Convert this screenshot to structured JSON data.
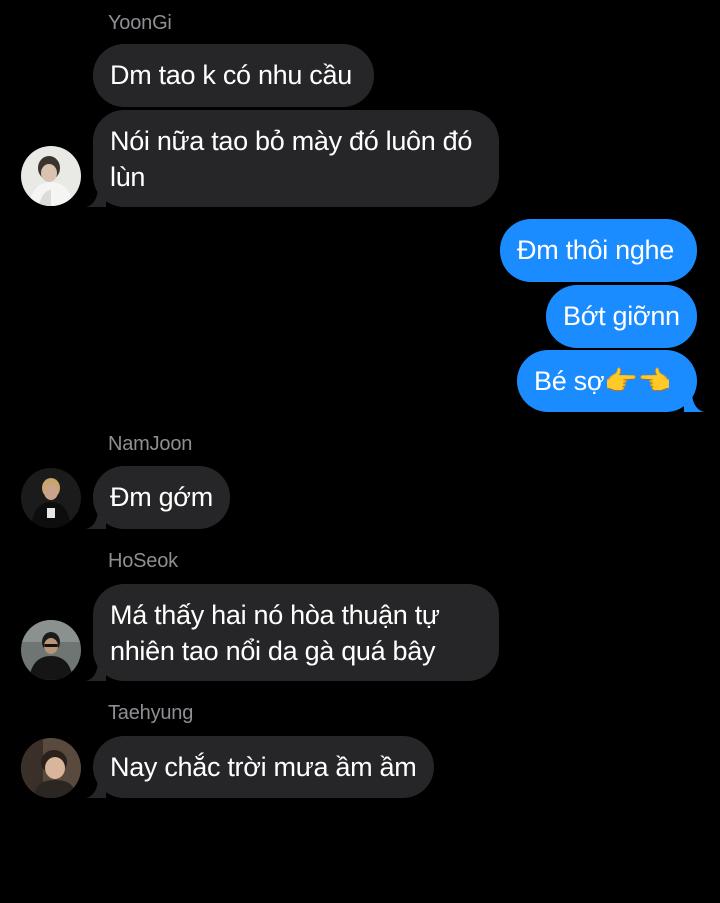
{
  "conversation": {
    "group_yoongi": {
      "sender": "YoonGi",
      "messages": [
        "Dm tao k có nhu cầu",
        "Nói nữa tao bỏ mày đó luôn đó lùn"
      ],
      "avatar": "yoongi-avatar"
    },
    "outgoing": {
      "messages": [
        "Đm thôi nghe",
        "Bớt giỡnn",
        "Bé sợ👉👈"
      ]
    },
    "group_namjoon": {
      "sender": "NamJoon",
      "messages": [
        "Đm gớm"
      ],
      "avatar": "namjoon-avatar"
    },
    "group_hoseok": {
      "sender": "HoSeok",
      "messages": [
        "Má thấy hai nó hòa thuận tự nhiên tao nổi da gà quá bây"
      ],
      "avatar": "hoseok-avatar"
    },
    "group_taehyung": {
      "sender": "Taehyung",
      "messages": [
        "Nay chắc trời mưa ầm ầm"
      ],
      "avatar": "taehyung-avatar"
    }
  },
  "colors": {
    "background": "#000000",
    "incoming_bubble": "#262628",
    "outgoing_bubble": "#1a8cff",
    "sender_name": "#8e8e93",
    "text": "#ffffff"
  }
}
